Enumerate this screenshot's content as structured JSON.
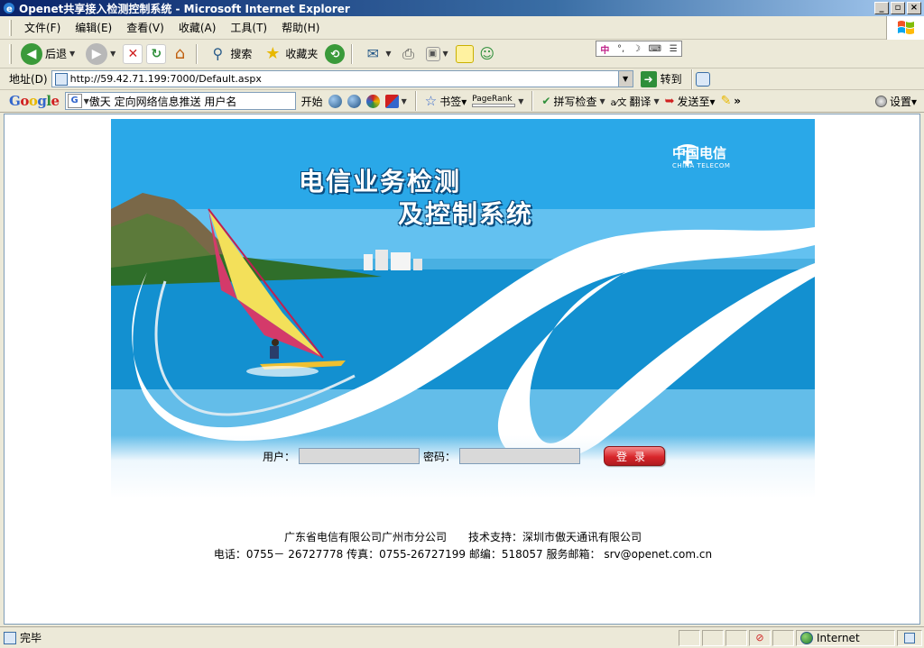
{
  "window": {
    "title": "Openet共享接入检测控制系统 - Microsoft Internet Explorer",
    "buttons": [
      "_",
      "▫",
      "×"
    ]
  },
  "menu": [
    "文件(F)",
    "编辑(E)",
    "查看(V)",
    "收藏(A)",
    "工具(T)",
    "帮助(H)"
  ],
  "toolbar": {
    "back": "后退",
    "search": "搜索",
    "favorites": "收藏夹"
  },
  "address": {
    "label": "地址(D)",
    "url": "http://59.42.71.199:7000/Default.aspx",
    "go": "转到"
  },
  "googlebar": {
    "logo": "Google",
    "search_text": "傲天 定向网络信息推送 用户名",
    "start": "开始",
    "bookmarks": "书签▾",
    "pagerank": "PageRank",
    "spellcheck": "拼写检查",
    "translate": "翻译",
    "sendto": "发送至▾",
    "more": "»",
    "settings": "设置▾"
  },
  "banner": {
    "title_line1": "电信业务检测",
    "title_line2": "及控制系统",
    "brand_cn": "中国电信",
    "brand_en": "CHINA TELECOM"
  },
  "login": {
    "user_label": "用户：",
    "password_label": "密码：",
    "button": "登录"
  },
  "footer": {
    "line1": "广东省电信有限公司广州市分公司　　技术支持：深圳市傲天通讯有限公司",
    "line2": "电话：0755－ 26727778 传真：0755-26727199 邮编：518057 服务邮箱： srv@openet.com.cn"
  },
  "status": {
    "text": "完毕",
    "zone": "Internet"
  }
}
